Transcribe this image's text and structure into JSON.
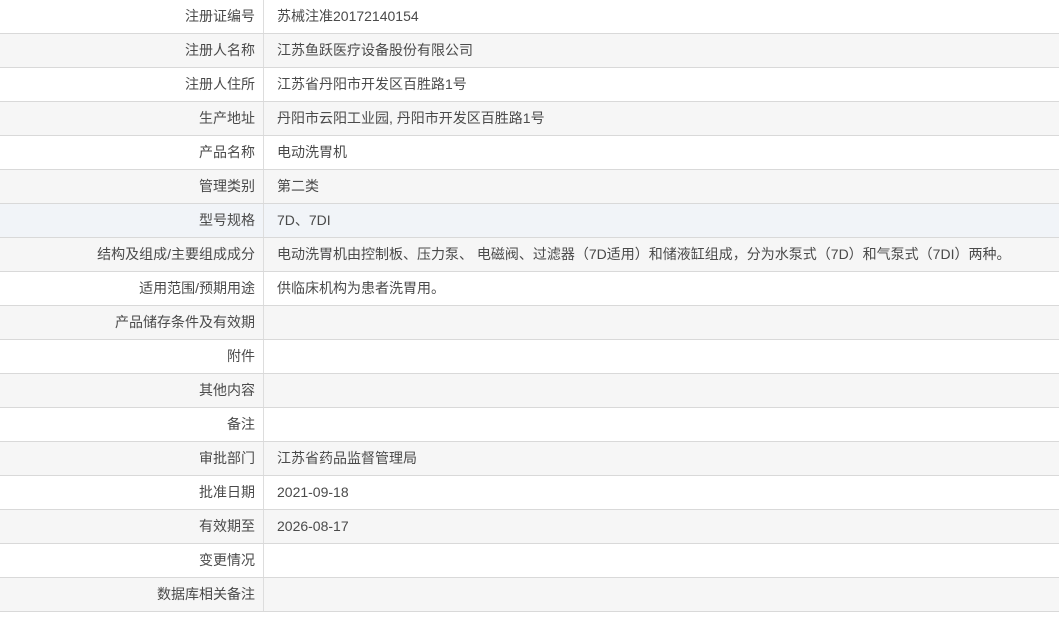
{
  "colors": {
    "row_alt_background": "#f6f6f6",
    "row_hover_background": "#f1f4f8",
    "row_border": "#d9d9d9",
    "column_divider": "#dddddd",
    "text": "#4a4a4a",
    "page_background": "#ffffff"
  },
  "table": {
    "rows": [
      {
        "label": "注册证编号",
        "value": "苏械注准20172140154"
      },
      {
        "label": "注册人名称",
        "value": "江苏鱼跃医疗设备股份有限公司"
      },
      {
        "label": "注册人住所",
        "value": "江苏省丹阳市开发区百胜路1号"
      },
      {
        "label": "生产地址",
        "value": "丹阳市云阳工业园, 丹阳市开发区百胜路1号"
      },
      {
        "label": "产品名称",
        "value": "电动洗胃机"
      },
      {
        "label": "管理类别",
        "value": "第二类"
      },
      {
        "label": "型号规格",
        "value": "7D、7DI"
      },
      {
        "label": "结构及组成/主要组成成分",
        "value": "电动洗胃机由控制板、压力泵、 电磁阀、过滤器（7D适用）和储液缸组成，分为水泵式（7D）和气泵式（7DI）两种。"
      },
      {
        "label": "适用范围/预期用途",
        "value": "供临床机构为患者洗胃用。"
      },
      {
        "label": "产品储存条件及有效期",
        "value": ""
      },
      {
        "label": "附件",
        "value": ""
      },
      {
        "label": "其他内容",
        "value": ""
      },
      {
        "label": "备注",
        "value": ""
      },
      {
        "label": "审批部门",
        "value": "江苏省药品监督管理局"
      },
      {
        "label": "批准日期",
        "value": "2021-09-18"
      },
      {
        "label": "有效期至",
        "value": "2026-08-17"
      },
      {
        "label": "变更情况",
        "value": ""
      },
      {
        "label": "数据库相关备注",
        "value": ""
      }
    ]
  }
}
